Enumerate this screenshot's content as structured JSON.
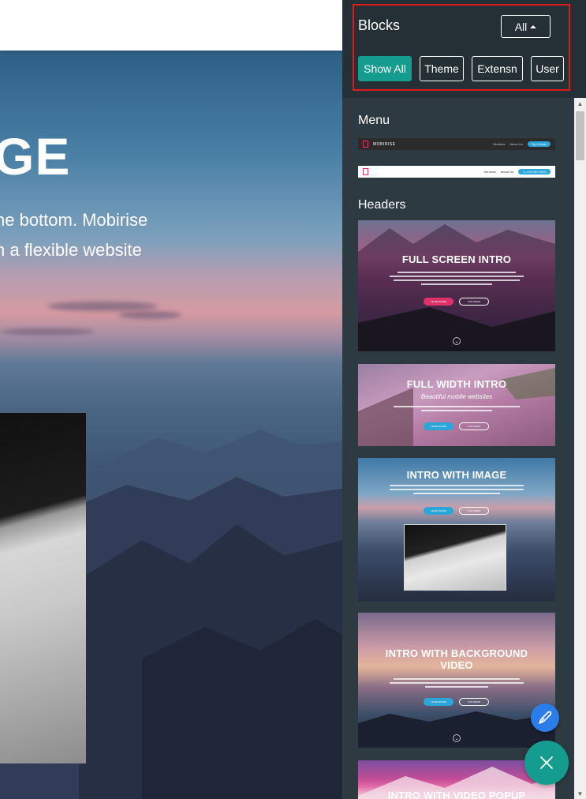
{
  "canvas": {
    "hero_title": "GE",
    "hero_line_1": "he bottom. Mobirise",
    "hero_line_2": "h a flexible website"
  },
  "panel": {
    "title": "Blocks",
    "filter_dropdown": "All",
    "filters": [
      "Show All",
      "Theme",
      "Extensn",
      "User"
    ],
    "active_filter": "Show All",
    "accent_color": "#149c8e",
    "highlight_color": "#e01b1b"
  },
  "sections": {
    "menu": {
      "title": "Menu",
      "thumb_1": {
        "logo": "MOBIRISE",
        "links": [
          "Services",
          "About Us"
        ],
        "button": "Try It Now!"
      },
      "thumb_2": {
        "links": [
          "Services",
          "About Us"
        ],
        "button": "+1-234-567-8901"
      }
    },
    "headers": {
      "title": "Headers",
      "thumbs": [
        {
          "title": "FULL SCREEN INTRO",
          "btn_primary": "LEARN MORE",
          "btn_secondary": "LIVE DEMO"
        },
        {
          "title": "FULL WIDTH INTRO",
          "subtitle": "Beautiful mobile websites",
          "btn_primary": "LEARN MORE",
          "btn_secondary": "LIVE DEMO"
        },
        {
          "title": "INTRO WITH IMAGE",
          "btn_primary": "LEARN MORE",
          "btn_secondary": "LIVE DEMO"
        },
        {
          "title": "INTRO WITH BACKGROUND VIDEO",
          "btn_primary": "LEARN MORE",
          "btn_secondary": "LIVE DEMO"
        },
        {
          "title": "INTRO WITH VIDEO POPUP"
        }
      ]
    }
  },
  "icons": {
    "edit_fab": "pencil-icon",
    "close_fab": "close-icon"
  }
}
